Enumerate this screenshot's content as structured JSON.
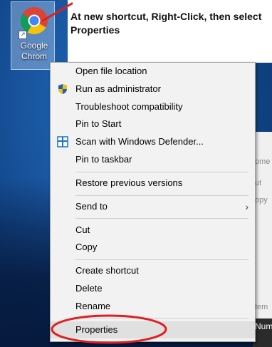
{
  "colors": {
    "callout_line": "#e02020",
    "highlight_ellipse": "#e02020",
    "menu_background": "#f2f2f2",
    "menu_highlight": "#e0e0e0"
  },
  "shortcut": {
    "label_line1": "Google",
    "label_line2": "Chrom",
    "icon": "chrome-icon"
  },
  "callout": {
    "text": "At new shortcut, Right-Click, then select Properties"
  },
  "menu": {
    "items": [
      {
        "label": "Open file location",
        "icon": ""
      },
      {
        "label": "Run as administrator",
        "icon": "uac-shield-icon"
      },
      {
        "label": "Troubleshoot compatibility",
        "icon": ""
      },
      {
        "label": "Pin to Start",
        "icon": ""
      },
      {
        "label": "Scan with Windows Defender...",
        "icon": "windows-defender-icon"
      },
      {
        "label": "Pin to taskbar",
        "icon": ""
      },
      {
        "label": "Restore previous versions",
        "icon": ""
      },
      {
        "label": "Send to",
        "icon": "",
        "submenu": true
      },
      {
        "label": "Cut",
        "icon": ""
      },
      {
        "label": "Copy",
        "icon": ""
      },
      {
        "label": "Create shortcut",
        "icon": ""
      },
      {
        "label": "Delete",
        "icon": ""
      },
      {
        "label": "Rename",
        "icon": ""
      },
      {
        "label": "Properties",
        "icon": "",
        "highlighted": true
      }
    ]
  },
  "background_window": {
    "fragments": [
      "ome",
      "ut",
      "opy",
      "tem",
      "Num"
    ]
  }
}
